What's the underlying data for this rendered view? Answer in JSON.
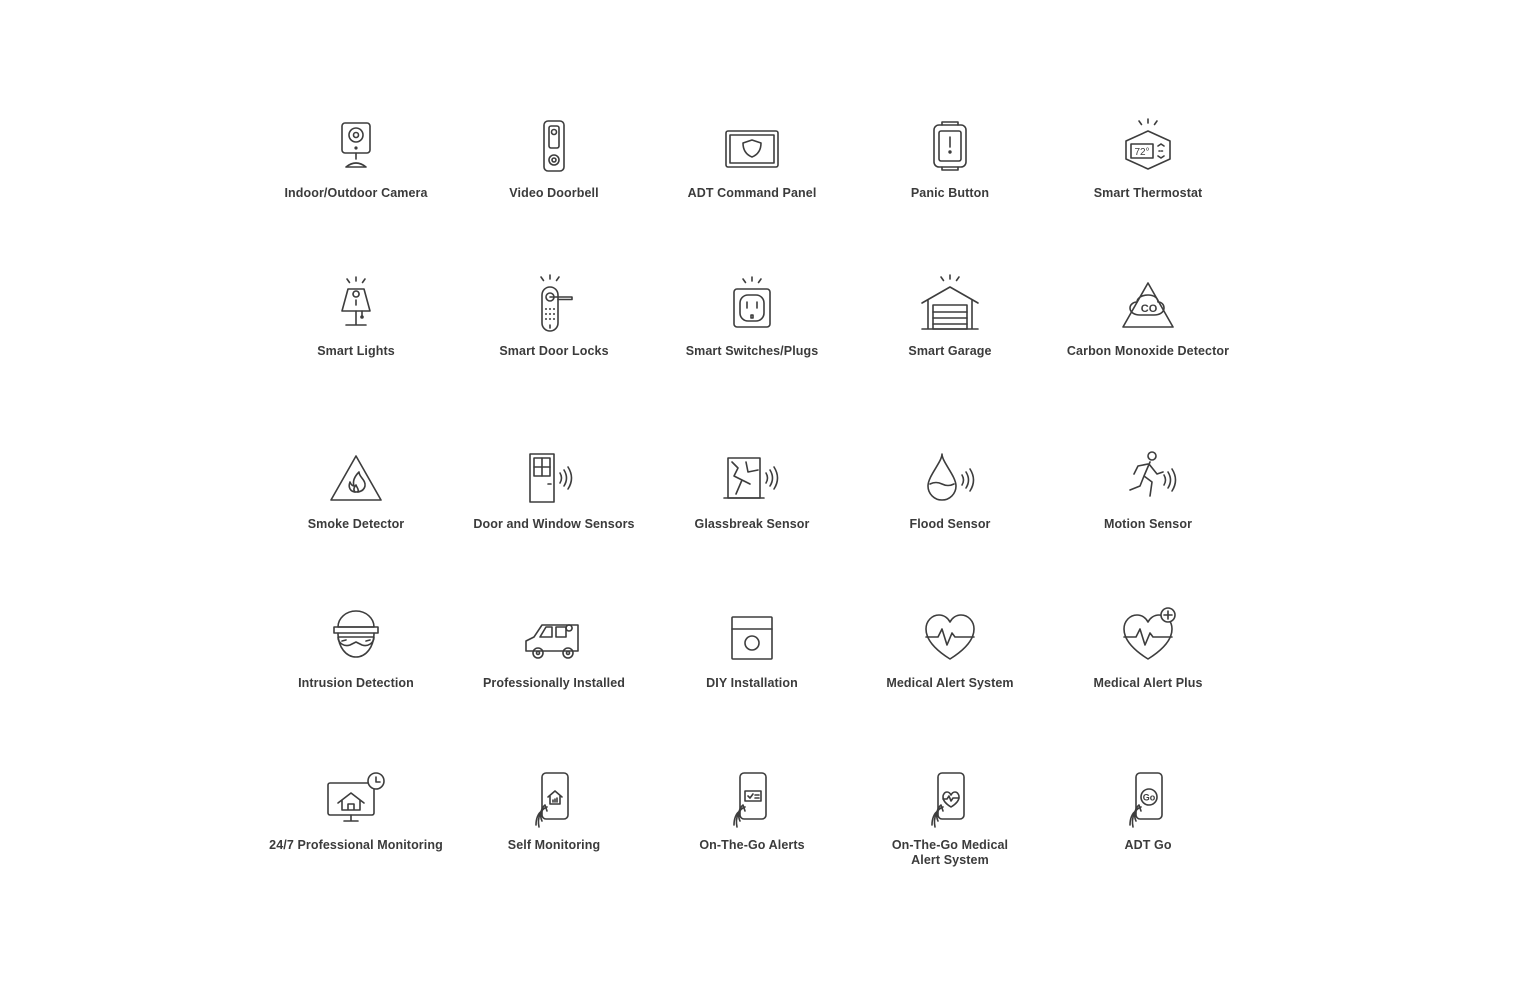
{
  "palette": {
    "stroke": "#3d3d3d",
    "text": "#3b3b3b",
    "background": "#ffffff"
  },
  "features": [
    {
      "label": "Indoor/Outdoor Camera",
      "icon": "camera-icon"
    },
    {
      "label": "Video Doorbell",
      "icon": "doorbell-icon"
    },
    {
      "label": "ADT Command Panel",
      "icon": "command-panel-icon"
    },
    {
      "label": "Panic Button",
      "icon": "panic-button-icon"
    },
    {
      "label": "Smart Thermostat",
      "icon": "thermostat-icon",
      "thermostat_reading": "72°"
    },
    {
      "label": "Smart Lights",
      "icon": "lamp-icon"
    },
    {
      "label": "Smart Door Locks",
      "icon": "door-lock-icon"
    },
    {
      "label": "Smart Switches/Plugs",
      "icon": "outlet-icon"
    },
    {
      "label": "Smart Garage",
      "icon": "garage-icon"
    },
    {
      "label": "Carbon Monoxide Detector",
      "icon": "co-warning-icon",
      "badge_text": "CO"
    },
    {
      "label": "Smoke Detector",
      "icon": "fire-warning-icon"
    },
    {
      "label": "Door and Window Sensors",
      "icon": "door-window-sensor-icon"
    },
    {
      "label": "Glassbreak Sensor",
      "icon": "glassbreak-icon"
    },
    {
      "label": "Flood Sensor",
      "icon": "water-drop-icon"
    },
    {
      "label": "Motion Sensor",
      "icon": "running-person-icon"
    },
    {
      "label": "Intrusion Detection",
      "icon": "burglar-icon"
    },
    {
      "label": "Professionally Installed",
      "icon": "van-icon"
    },
    {
      "label": "DIY Installation",
      "icon": "box-icon"
    },
    {
      "label": "Medical Alert System",
      "icon": "heartbeat-icon"
    },
    {
      "label": "Medical Alert Plus",
      "icon": "heartbeat-plus-icon"
    },
    {
      "label": "24/7 Professional Monitoring",
      "icon": "monitor-clock-icon"
    },
    {
      "label": "Self Monitoring",
      "icon": "phone-home-icon"
    },
    {
      "label": "On-The-Go Alerts",
      "icon": "phone-alert-icon"
    },
    {
      "label": "On-The-Go Medical\nAlert System",
      "icon": "phone-heart-icon"
    },
    {
      "label": "ADT Go",
      "icon": "phone-go-icon",
      "badge_text": "Go"
    }
  ]
}
